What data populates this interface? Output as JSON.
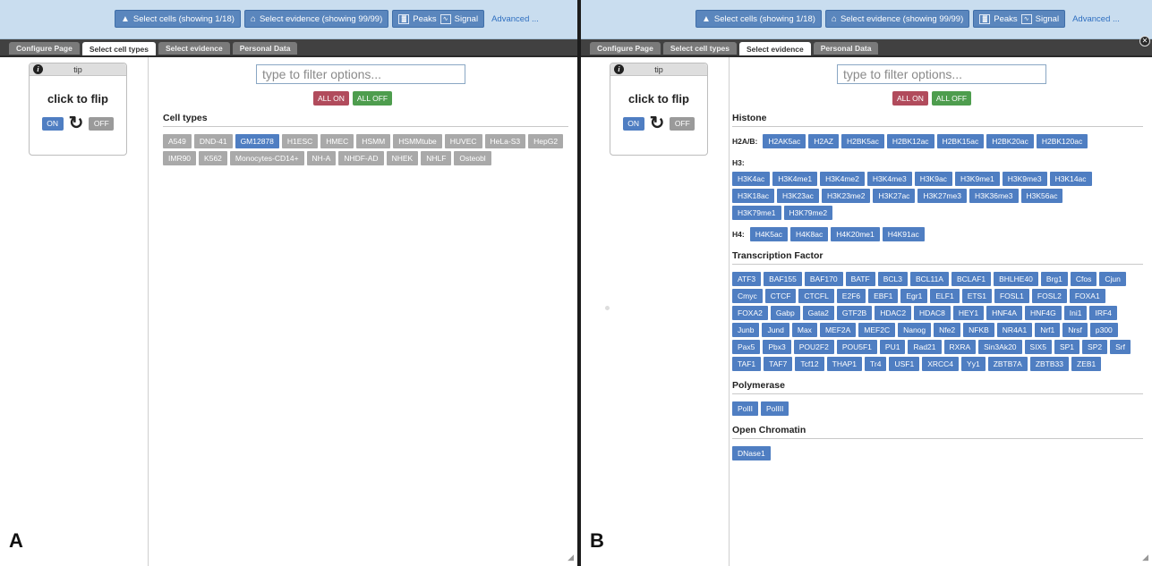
{
  "topbar": {
    "select_cells": "Select cells (showing 1/18)",
    "select_evidence": "Select evidence (showing 99/99)",
    "peaks": "Peaks",
    "signal": "Signal",
    "advanced": "Advanced ..."
  },
  "tabs": {
    "configure": "Configure Page",
    "cell_types": "Select cell types",
    "evidence": "Select evidence",
    "personal": "Personal Data"
  },
  "tip": {
    "header": "tip",
    "info": "i",
    "title": "click to flip",
    "on": "ON",
    "off": "OFF"
  },
  "filter_placeholder": "type to filter options...",
  "all_on": "ALL ON",
  "all_off": "ALL OFF",
  "panelA": {
    "letter": "A",
    "section_title": "Cell types",
    "cells": [
      {
        "label": "A549",
        "on": false
      },
      {
        "label": "DND-41",
        "on": false
      },
      {
        "label": "GM12878",
        "on": true
      },
      {
        "label": "H1ESC",
        "on": false
      },
      {
        "label": "HMEC",
        "on": false
      },
      {
        "label": "HSMM",
        "on": false
      },
      {
        "label": "HSMMtube",
        "on": false
      },
      {
        "label": "HUVEC",
        "on": false
      },
      {
        "label": "HeLa-S3",
        "on": false
      },
      {
        "label": "HepG2",
        "on": false
      },
      {
        "label": "IMR90",
        "on": false
      },
      {
        "label": "K562",
        "on": false
      },
      {
        "label": "Monocytes-CD14+",
        "on": false
      },
      {
        "label": "NH-A",
        "on": false
      },
      {
        "label": "NHDF-AD",
        "on": false
      },
      {
        "label": "NHEK",
        "on": false
      },
      {
        "label": "NHLF",
        "on": false
      },
      {
        "label": "Osteobl",
        "on": false
      }
    ]
  },
  "panelB": {
    "letter": "B",
    "histone": {
      "title": "Histone",
      "h2ab_label": "H2A/B:",
      "h2ab": [
        "H2AK5ac",
        "H2AZ",
        "H2BK5ac",
        "H2BK12ac",
        "H2BK15ac",
        "H2BK20ac",
        "H2BK120ac"
      ],
      "h3_label": "H3:",
      "h3": [
        "H3K4ac",
        "H3K4me1",
        "H3K4me2",
        "H3K4me3",
        "H3K9ac",
        "H3K9me1",
        "H3K9me3",
        "H3K14ac",
        "H3K18ac",
        "H3K23ac",
        "H3K23me2",
        "H3K27ac",
        "H3K27me3",
        "H3K36me3",
        "H3K56ac",
        "H3K79me1",
        "H3K79me2"
      ],
      "h4_label": "H4:",
      "h4": [
        "H4K5ac",
        "H4K8ac",
        "H4K20me1",
        "H4K91ac"
      ]
    },
    "tf": {
      "title": "Transcription Factor",
      "items": [
        "ATF3",
        "BAF155",
        "BAF170",
        "BATF",
        "BCL3",
        "BCL11A",
        "BCLAF1",
        "BHLHE40",
        "Brg1",
        "Cfos",
        "Cjun",
        "Cmyc",
        "CTCF",
        "CTCFL",
        "E2F6",
        "EBF1",
        "Egr1",
        "ELF1",
        "ETS1",
        "FOSL1",
        "FOSL2",
        "FOXA1",
        "FOXA2",
        "Gabp",
        "Gata2",
        "GTF2B",
        "HDAC2",
        "HDAC8",
        "HEY1",
        "HNF4A",
        "HNF4G",
        "Ini1",
        "IRF4",
        "Junb",
        "Jund",
        "Max",
        "MEF2A",
        "MEF2C",
        "Nanog",
        "Nfe2",
        "NFKB",
        "NR4A1",
        "Nrf1",
        "Nrsf",
        "p300",
        "Pax5",
        "Pbx3",
        "POU2F2",
        "POU5F1",
        "PU1",
        "Rad21",
        "RXRA",
        "Sin3Ak20",
        "SIX5",
        "SP1",
        "SP2",
        "Srf",
        "TAF1",
        "TAF7",
        "Tcf12",
        "THAP1",
        "Tr4",
        "USF1",
        "XRCC4",
        "Yy1",
        "ZBTB7A",
        "ZBTB33",
        "ZEB1"
      ]
    },
    "polymerase": {
      "title": "Polymerase",
      "items": [
        "PolII",
        "PolIII"
      ]
    },
    "chromatin": {
      "title": "Open Chromatin",
      "items": [
        "DNase1"
      ]
    }
  }
}
